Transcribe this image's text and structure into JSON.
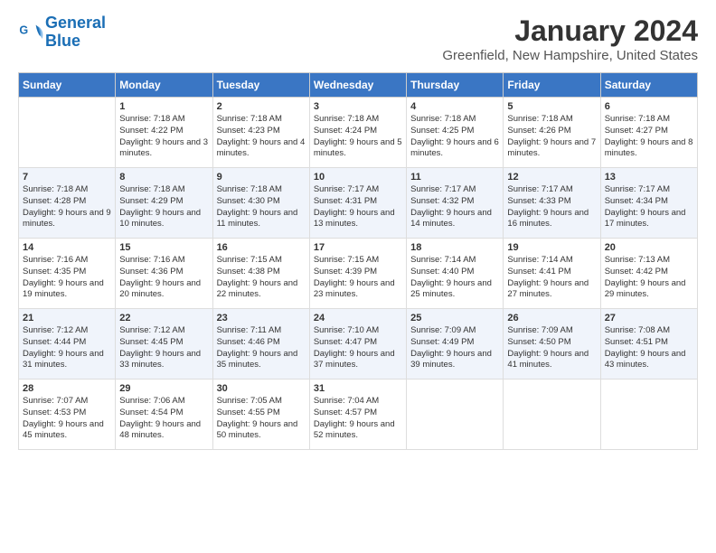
{
  "logo": {
    "line1": "General",
    "line2": "Blue"
  },
  "title": "January 2024",
  "subtitle": "Greenfield, New Hampshire, United States",
  "days_of_week": [
    "Sunday",
    "Monday",
    "Tuesday",
    "Wednesday",
    "Thursday",
    "Friday",
    "Saturday"
  ],
  "weeks": [
    [
      {
        "day": "",
        "sunrise": "",
        "sunset": "",
        "daylight": ""
      },
      {
        "day": "1",
        "sunrise": "Sunrise: 7:18 AM",
        "sunset": "Sunset: 4:22 PM",
        "daylight": "Daylight: 9 hours and 3 minutes."
      },
      {
        "day": "2",
        "sunrise": "Sunrise: 7:18 AM",
        "sunset": "Sunset: 4:23 PM",
        "daylight": "Daylight: 9 hours and 4 minutes."
      },
      {
        "day": "3",
        "sunrise": "Sunrise: 7:18 AM",
        "sunset": "Sunset: 4:24 PM",
        "daylight": "Daylight: 9 hours and 5 minutes."
      },
      {
        "day": "4",
        "sunrise": "Sunrise: 7:18 AM",
        "sunset": "Sunset: 4:25 PM",
        "daylight": "Daylight: 9 hours and 6 minutes."
      },
      {
        "day": "5",
        "sunrise": "Sunrise: 7:18 AM",
        "sunset": "Sunset: 4:26 PM",
        "daylight": "Daylight: 9 hours and 7 minutes."
      },
      {
        "day": "6",
        "sunrise": "Sunrise: 7:18 AM",
        "sunset": "Sunset: 4:27 PM",
        "daylight": "Daylight: 9 hours and 8 minutes."
      }
    ],
    [
      {
        "day": "7",
        "sunrise": "Sunrise: 7:18 AM",
        "sunset": "Sunset: 4:28 PM",
        "daylight": "Daylight: 9 hours and 9 minutes."
      },
      {
        "day": "8",
        "sunrise": "Sunrise: 7:18 AM",
        "sunset": "Sunset: 4:29 PM",
        "daylight": "Daylight: 9 hours and 10 minutes."
      },
      {
        "day": "9",
        "sunrise": "Sunrise: 7:18 AM",
        "sunset": "Sunset: 4:30 PM",
        "daylight": "Daylight: 9 hours and 11 minutes."
      },
      {
        "day": "10",
        "sunrise": "Sunrise: 7:17 AM",
        "sunset": "Sunset: 4:31 PM",
        "daylight": "Daylight: 9 hours and 13 minutes."
      },
      {
        "day": "11",
        "sunrise": "Sunrise: 7:17 AM",
        "sunset": "Sunset: 4:32 PM",
        "daylight": "Daylight: 9 hours and 14 minutes."
      },
      {
        "day": "12",
        "sunrise": "Sunrise: 7:17 AM",
        "sunset": "Sunset: 4:33 PM",
        "daylight": "Daylight: 9 hours and 16 minutes."
      },
      {
        "day": "13",
        "sunrise": "Sunrise: 7:17 AM",
        "sunset": "Sunset: 4:34 PM",
        "daylight": "Daylight: 9 hours and 17 minutes."
      }
    ],
    [
      {
        "day": "14",
        "sunrise": "Sunrise: 7:16 AM",
        "sunset": "Sunset: 4:35 PM",
        "daylight": "Daylight: 9 hours and 19 minutes."
      },
      {
        "day": "15",
        "sunrise": "Sunrise: 7:16 AM",
        "sunset": "Sunset: 4:36 PM",
        "daylight": "Daylight: 9 hours and 20 minutes."
      },
      {
        "day": "16",
        "sunrise": "Sunrise: 7:15 AM",
        "sunset": "Sunset: 4:38 PM",
        "daylight": "Daylight: 9 hours and 22 minutes."
      },
      {
        "day": "17",
        "sunrise": "Sunrise: 7:15 AM",
        "sunset": "Sunset: 4:39 PM",
        "daylight": "Daylight: 9 hours and 23 minutes."
      },
      {
        "day": "18",
        "sunrise": "Sunrise: 7:14 AM",
        "sunset": "Sunset: 4:40 PM",
        "daylight": "Daylight: 9 hours and 25 minutes."
      },
      {
        "day": "19",
        "sunrise": "Sunrise: 7:14 AM",
        "sunset": "Sunset: 4:41 PM",
        "daylight": "Daylight: 9 hours and 27 minutes."
      },
      {
        "day": "20",
        "sunrise": "Sunrise: 7:13 AM",
        "sunset": "Sunset: 4:42 PM",
        "daylight": "Daylight: 9 hours and 29 minutes."
      }
    ],
    [
      {
        "day": "21",
        "sunrise": "Sunrise: 7:12 AM",
        "sunset": "Sunset: 4:44 PM",
        "daylight": "Daylight: 9 hours and 31 minutes."
      },
      {
        "day": "22",
        "sunrise": "Sunrise: 7:12 AM",
        "sunset": "Sunset: 4:45 PM",
        "daylight": "Daylight: 9 hours and 33 minutes."
      },
      {
        "day": "23",
        "sunrise": "Sunrise: 7:11 AM",
        "sunset": "Sunset: 4:46 PM",
        "daylight": "Daylight: 9 hours and 35 minutes."
      },
      {
        "day": "24",
        "sunrise": "Sunrise: 7:10 AM",
        "sunset": "Sunset: 4:47 PM",
        "daylight": "Daylight: 9 hours and 37 minutes."
      },
      {
        "day": "25",
        "sunrise": "Sunrise: 7:09 AM",
        "sunset": "Sunset: 4:49 PM",
        "daylight": "Daylight: 9 hours and 39 minutes."
      },
      {
        "day": "26",
        "sunrise": "Sunrise: 7:09 AM",
        "sunset": "Sunset: 4:50 PM",
        "daylight": "Daylight: 9 hours and 41 minutes."
      },
      {
        "day": "27",
        "sunrise": "Sunrise: 7:08 AM",
        "sunset": "Sunset: 4:51 PM",
        "daylight": "Daylight: 9 hours and 43 minutes."
      }
    ],
    [
      {
        "day": "28",
        "sunrise": "Sunrise: 7:07 AM",
        "sunset": "Sunset: 4:53 PM",
        "daylight": "Daylight: 9 hours and 45 minutes."
      },
      {
        "day": "29",
        "sunrise": "Sunrise: 7:06 AM",
        "sunset": "Sunset: 4:54 PM",
        "daylight": "Daylight: 9 hours and 48 minutes."
      },
      {
        "day": "30",
        "sunrise": "Sunrise: 7:05 AM",
        "sunset": "Sunset: 4:55 PM",
        "daylight": "Daylight: 9 hours and 50 minutes."
      },
      {
        "day": "31",
        "sunrise": "Sunrise: 7:04 AM",
        "sunset": "Sunset: 4:57 PM",
        "daylight": "Daylight: 9 hours and 52 minutes."
      },
      {
        "day": "",
        "sunrise": "",
        "sunset": "",
        "daylight": ""
      },
      {
        "day": "",
        "sunrise": "",
        "sunset": "",
        "daylight": ""
      },
      {
        "day": "",
        "sunrise": "",
        "sunset": "",
        "daylight": ""
      }
    ]
  ]
}
